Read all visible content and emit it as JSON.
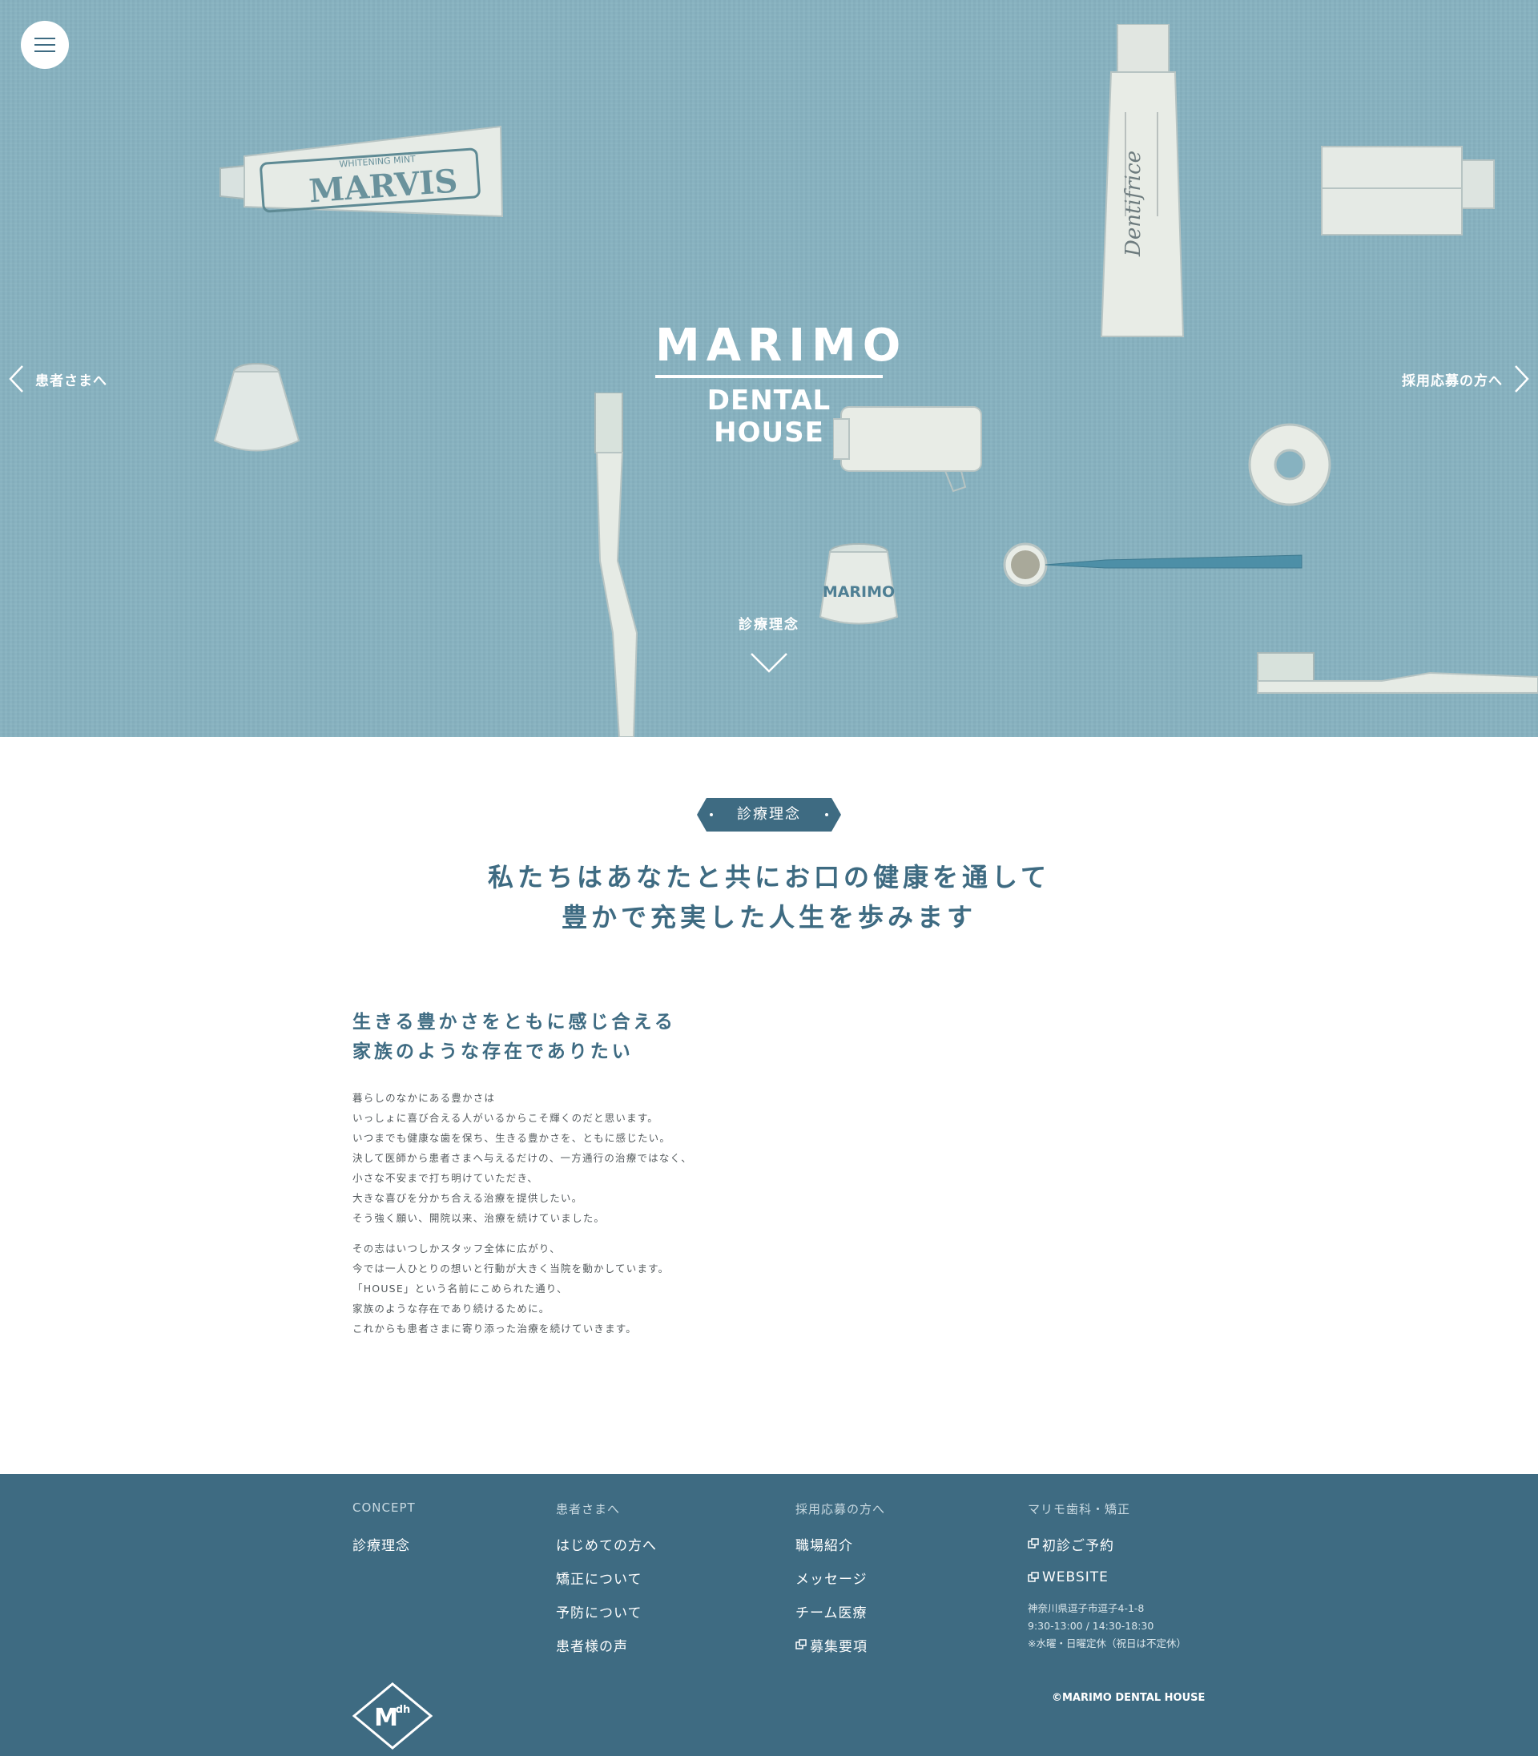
{
  "hero": {
    "logo_line1": "MARIMO",
    "logo_line2": "DENTAL HOUSE",
    "nav_left": "患者さまへ",
    "nav_right": "採用応募の方へ",
    "scroll_label": "診療理念",
    "illustration_text": {
      "tube_brand": "MARVIS",
      "tube_small": "WHITENING MINT",
      "dentifrice": "Dentifrice",
      "cup_label": "MARIMO"
    }
  },
  "concept": {
    "badge": "診療理念",
    "lead_line1": "私たちはあなたと共にお口の健康を通して",
    "lead_line2": "豊かで充実した人生を歩みます",
    "sub_line1": "生きる豊かさをともに感じ合える",
    "sub_line2": "家族のような存在でありたい",
    "paragraph1": [
      "暮らしのなかにある豊かさは",
      "いっしょに喜び合える人がいるからこそ輝くのだと思います。",
      "いつまでも健康な歯を保ち、生きる豊かさを、ともに感じたい。",
      "決して医師から患者さまへ与えるだけの、一方通行の治療ではなく、",
      "小さな不安まで打ち明けていただき、",
      "大きな喜びを分かち合える治療を提供したい。",
      "そう強く願い、開院以来、治療を続けていました。"
    ],
    "paragraph2": [
      "その志はいつしかスタッフ全体に広がり、",
      "今では一人ひとりの想いと行動が大きく当院を動かしています。",
      "「HOUSE」という名前にこめられた通り、",
      "家族のような存在であり続けるために。",
      "これからも患者さまに寄り添った治療を続けていきます。"
    ]
  },
  "footer": {
    "col1": {
      "head": "CONCEPT",
      "links": [
        "診療理念"
      ]
    },
    "col2": {
      "head": "患者さまへ",
      "links": [
        "はじめての方へ",
        "矯正について",
        "予防について",
        "患者様の声"
      ]
    },
    "col3": {
      "head": "採用応募の方へ",
      "links": [
        "職場紹介",
        "メッセージ",
        "チーム医療",
        "募集要項"
      ]
    },
    "col4": {
      "head": "マリモ歯科・矯正",
      "links": [
        "初診ご予約",
        "WEBSITE"
      ],
      "address": "神奈川県逗子市逗子4-1-8",
      "hours": "9:30-13:00 / 14:30-18:30",
      "closed": "※水曜・日曜定休（祝日は不定休）"
    },
    "logo_text": "M",
    "logo_sup": "dh",
    "copyright": "©MARIMO DENTAL HOUSE"
  },
  "colors": {
    "hero_bg": "#87b2c0",
    "primary": "#3e6b82",
    "white": "#ffffff",
    "body_text": "#555b5e"
  },
  "icons": [
    "hamburger-menu-icon",
    "chevron-left-icon",
    "chevron-right-icon",
    "chevron-down-icon",
    "external-link-icon",
    "mdh-logo-icon"
  ]
}
